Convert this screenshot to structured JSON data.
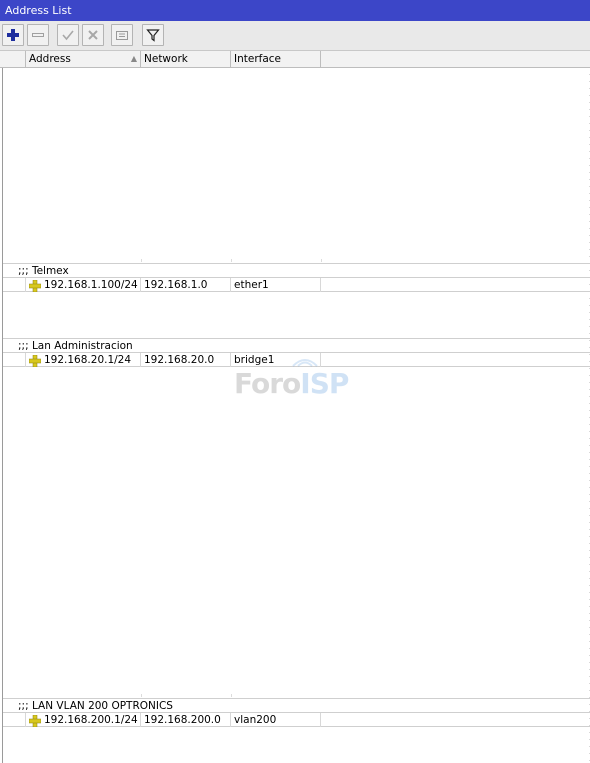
{
  "window": {
    "title": "Address List"
  },
  "toolbar": {
    "buttons": [
      {
        "name": "add",
        "icon": "plus-icon"
      },
      {
        "name": "remove",
        "icon": "minus-icon"
      },
      {
        "name": "enable",
        "icon": "check-icon"
      },
      {
        "name": "disable",
        "icon": "cross-icon"
      },
      {
        "name": "comment",
        "icon": "comment-icon"
      },
      {
        "name": "filter",
        "icon": "filter-icon"
      }
    ]
  },
  "table": {
    "columns": [
      "Address",
      "Network",
      "Interface"
    ],
    "sort_indicator": "▲",
    "groups": [
      {
        "comment": ";;; Telmex",
        "address": "192.168.1.100/24",
        "network": "192.168.1.0",
        "interface": "ether1"
      },
      {
        "comment": ";;; Lan Administracion",
        "address": "192.168.20.1/24",
        "network": "192.168.20.0",
        "interface": "bridge1"
      },
      {
        "comment": ";;; LAN VLAN 200 OPTRONICS",
        "address": "192.168.200.1/24",
        "network": "192.168.200.0",
        "interface": "vlan200"
      }
    ]
  },
  "watermark": {
    "part1": "Foro",
    "part2": "ISP"
  },
  "colors": {
    "titlebar": "#3c46c8",
    "row_icon": "#d8c81e",
    "add_icon": "#1e2e9e"
  }
}
